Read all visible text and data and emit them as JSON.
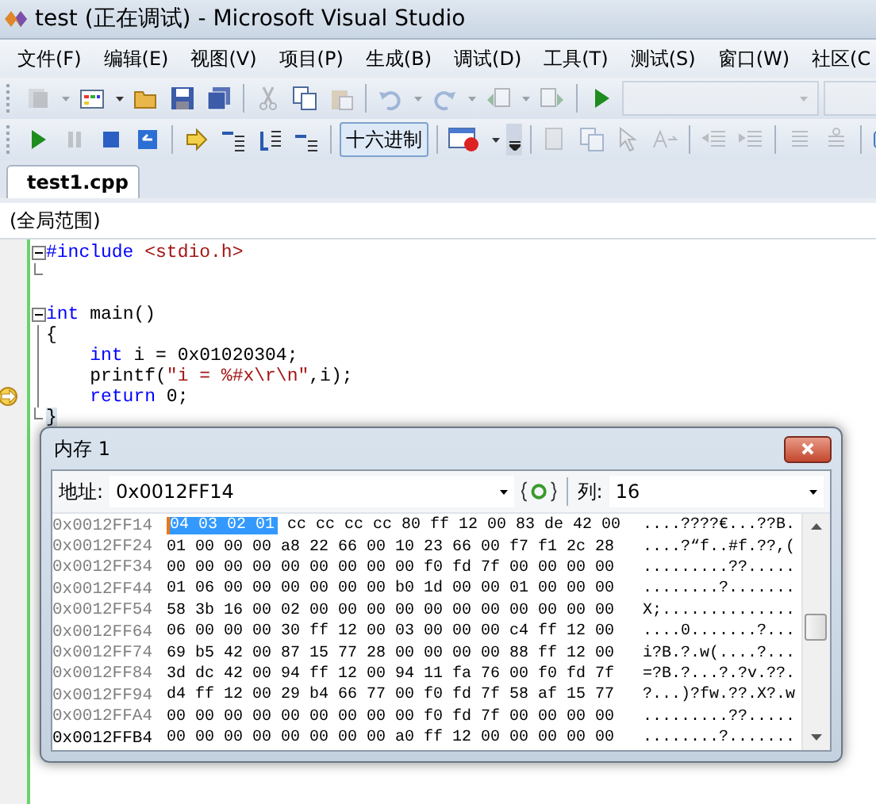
{
  "window": {
    "title": "test (正在调试) - Microsoft Visual Studio"
  },
  "menu": [
    "文件(F)",
    "编辑(E)",
    "视图(V)",
    "项目(P)",
    "生成(B)",
    "调试(D)",
    "工具(T)",
    "测试(S)",
    "窗口(W)",
    "社区(C"
  ],
  "toolbar_1": [
    {
      "kind": "new-project",
      "disabled": true
    },
    {
      "kind": "dropdown",
      "disabled": true
    },
    {
      "kind": "add-item",
      "disabled": false
    },
    {
      "kind": "dropdown",
      "disabled": false
    },
    {
      "kind": "open",
      "disabled": false
    },
    {
      "kind": "save",
      "disabled": false
    },
    {
      "kind": "save-all",
      "disabled": false
    },
    {
      "kind": "separator"
    },
    {
      "kind": "cut",
      "disabled": true
    },
    {
      "kind": "copy",
      "disabled": false
    },
    {
      "kind": "paste",
      "disabled": true
    },
    {
      "kind": "separator"
    },
    {
      "kind": "undo",
      "disabled": true
    },
    {
      "kind": "dropdown",
      "disabled": true
    },
    {
      "kind": "redo",
      "disabled": true
    },
    {
      "kind": "dropdown",
      "disabled": true
    },
    {
      "kind": "back",
      "disabled": true
    },
    {
      "kind": "dropdown",
      "disabled": true
    },
    {
      "kind": "forward",
      "disabled": true
    },
    {
      "kind": "separator"
    },
    {
      "kind": "start",
      "disabled": false
    },
    {
      "kind": "combo",
      "disabled": true
    },
    {
      "kind": "combo-wide",
      "disabled": true
    }
  ],
  "toolbar_2": [
    {
      "kind": "start",
      "disabled": false
    },
    {
      "kind": "pause",
      "disabled": true
    },
    {
      "kind": "stop",
      "disabled": false
    },
    {
      "kind": "restart",
      "disabled": false
    },
    {
      "kind": "separator"
    },
    {
      "kind": "next-statement",
      "disabled": false
    },
    {
      "kind": "step-into",
      "disabled": false
    },
    {
      "kind": "step-over",
      "disabled": false
    },
    {
      "kind": "step-out",
      "disabled": false
    },
    {
      "kind": "separator"
    },
    {
      "kind": "text",
      "label": "十六进制",
      "pressed": true
    },
    {
      "kind": "separator"
    },
    {
      "kind": "breakpoints",
      "disabled": false
    },
    {
      "kind": "dropdown",
      "disabled": false
    },
    {
      "kind": "overflow"
    },
    {
      "kind": "separator"
    },
    {
      "kind": "edit-doc",
      "disabled": true
    },
    {
      "kind": "copy",
      "disabled": true
    },
    {
      "kind": "cursor",
      "disabled": true
    },
    {
      "kind": "font",
      "disabled": true
    },
    {
      "kind": "separator"
    },
    {
      "kind": "outdent",
      "disabled": true
    },
    {
      "kind": "indent",
      "disabled": true
    },
    {
      "kind": "separator"
    },
    {
      "kind": "lines",
      "disabled": true
    },
    {
      "kind": "uncomment",
      "disabled": true
    },
    {
      "kind": "separator"
    },
    {
      "kind": "window",
      "disabled": false
    }
  ],
  "tabs": [
    {
      "label": "test1.cpp",
      "selected": true
    }
  ],
  "scope": "(全局范围)",
  "code": [
    {
      "kind": "start",
      "current": false,
      "tokens": [
        {
          "kind": "keyword",
          "text": "#include"
        },
        {
          "kind": "string",
          "text": " <stdio.h>"
        }
      ]
    },
    {
      "kind": "end",
      "current": false
    },
    {
      "kind": "none",
      "current": false
    },
    {
      "kind": "start",
      "current": false,
      "tokens": [
        {
          "kind": "keyword",
          "text": "int"
        },
        {
          "kind": "plain",
          "text": " main()"
        }
      ]
    },
    {
      "kind": "line",
      "current": false,
      "tokens": [
        {
          "kind": "plain",
          "text": "{"
        }
      ]
    },
    {
      "kind": "line",
      "current": false,
      "tokens": [
        {
          "kind": "keyword",
          "text": "    int"
        },
        {
          "kind": "plain",
          "text": " i = 0x01020304;"
        }
      ]
    },
    {
      "kind": "line",
      "current": false,
      "tokens": [
        {
          "kind": "plain",
          "text": "    printf("
        },
        {
          "kind": "string",
          "text": "\"i = %#x\\r\\n\""
        },
        {
          "kind": "plain",
          "text": ",i);"
        }
      ]
    },
    {
      "kind": "line",
      "current": true,
      "tokens": [
        {
          "kind": "keyword",
          "text": "    return"
        },
        {
          "kind": "plain",
          "text": " 0;"
        }
      ]
    },
    {
      "kind": "end",
      "current": false,
      "tokens": [
        {
          "kind": "brace",
          "text": "}"
        }
      ]
    }
  ],
  "memory": {
    "title": "内存 1",
    "address_label": "地址:",
    "address": "0x0012FF14",
    "columns_label": "列:",
    "columns": "16",
    "rows": [
      {
        "address": "0x0012FF14",
        "active": false,
        "selected_bytes": [
          "04",
          "03",
          "02",
          "01"
        ],
        "bytes": [
          "cc",
          "cc",
          "cc",
          "cc",
          "80",
          "ff",
          "12",
          "00",
          "83",
          "de",
          "42",
          "00"
        ],
        "text": "....????€...??B."
      },
      {
        "address": "0x0012FF24",
        "active": false,
        "bytes": [
          "01",
          "00",
          "00",
          "00",
          "a8",
          "22",
          "66",
          "00",
          "10",
          "23",
          "66",
          "00",
          "f7",
          "f1",
          "2c",
          "28"
        ],
        "text": "....?“f..#f.??,("
      },
      {
        "address": "0x0012FF34",
        "active": false,
        "bytes": [
          "00",
          "00",
          "00",
          "00",
          "00",
          "00",
          "00",
          "00",
          "00",
          "f0",
          "fd",
          "7f",
          "00",
          "00",
          "00",
          "00"
        ],
        "text": ".........??....."
      },
      {
        "address": "0x0012FF44",
        "active": false,
        "bytes": [
          "01",
          "06",
          "00",
          "00",
          "00",
          "00",
          "00",
          "00",
          "b0",
          "1d",
          "00",
          "00",
          "01",
          "00",
          "00",
          "00"
        ],
        "text": "........?......."
      },
      {
        "address": "0x0012FF54",
        "active": false,
        "bytes": [
          "58",
          "3b",
          "16",
          "00",
          "02",
          "00",
          "00",
          "00",
          "00",
          "00",
          "00",
          "00",
          "00",
          "00",
          "00",
          "00"
        ],
        "text": "X;.............."
      },
      {
        "address": "0x0012FF64",
        "active": false,
        "bytes": [
          "06",
          "00",
          "00",
          "00",
          "30",
          "ff",
          "12",
          "00",
          "03",
          "00",
          "00",
          "00",
          "c4",
          "ff",
          "12",
          "00"
        ],
        "text": "....0.......?..."
      },
      {
        "address": "0x0012FF74",
        "active": false,
        "bytes": [
          "69",
          "b5",
          "42",
          "00",
          "87",
          "15",
          "77",
          "28",
          "00",
          "00",
          "00",
          "00",
          "88",
          "ff",
          "12",
          "00"
        ],
        "text": "i?B.?.w(....?..."
      },
      {
        "address": "0x0012FF84",
        "active": false,
        "bytes": [
          "3d",
          "dc",
          "42",
          "00",
          "94",
          "ff",
          "12",
          "00",
          "94",
          "11",
          "fa",
          "76",
          "00",
          "f0",
          "fd",
          "7f"
        ],
        "text": "=?B.?...?.?v.??."
      },
      {
        "address": "0x0012FF94",
        "active": false,
        "bytes": [
          "d4",
          "ff",
          "12",
          "00",
          "29",
          "b4",
          "66",
          "77",
          "00",
          "f0",
          "fd",
          "7f",
          "58",
          "af",
          "15",
          "77"
        ],
        "text": "?...)?fw.??.X?.w"
      },
      {
        "address": "0x0012FFA4",
        "active": false,
        "bytes": [
          "00",
          "00",
          "00",
          "00",
          "00",
          "00",
          "00",
          "00",
          "00",
          "f0",
          "fd",
          "7f",
          "00",
          "00",
          "00",
          "00"
        ],
        "text": ".........??....."
      },
      {
        "address": "0x0012FFB4",
        "active": true,
        "bytes": [
          "00",
          "00",
          "00",
          "00",
          "00",
          "00",
          "00",
          "00",
          "a0",
          "ff",
          "12",
          "00",
          "00",
          "00",
          "00",
          "00"
        ],
        "text": "........?......."
      }
    ]
  }
}
